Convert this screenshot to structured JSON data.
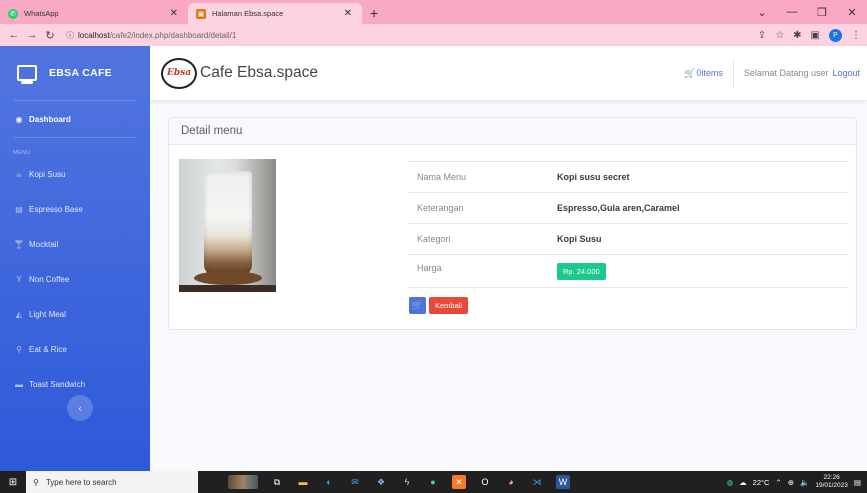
{
  "browser": {
    "tabs": [
      {
        "label": "WhatsApp",
        "favicon_color": "#25d366",
        "favicon": "whatsapp-icon"
      },
      {
        "label": "Halaman Ebsa.space",
        "favicon_color": "#e8710a",
        "favicon": "page-icon"
      }
    ],
    "url_host": "localhost",
    "url_path": "/cafe2/index.php/dashboard/detail/1",
    "profile_initial": "P"
  },
  "sidebar": {
    "brand": "EBSA CAFE",
    "dashboard": "Dashboard",
    "heading": "MENU",
    "items": [
      {
        "label": "Kopi Susu",
        "icon": "coffee-icon"
      },
      {
        "label": "Espresso Base",
        "icon": "book-icon"
      },
      {
        "label": "Mocktail",
        "icon": "cocktail-icon"
      },
      {
        "label": "Non Coffee",
        "icon": "glass-icon"
      },
      {
        "label": "Light Meal",
        "icon": "food-icon"
      },
      {
        "label": "Eat & Rice",
        "icon": "drumstick-icon"
      },
      {
        "label": "Toast Sandwich",
        "icon": "bread-icon"
      }
    ]
  },
  "topbar": {
    "logo_text": "Ebsa",
    "site_name": "Cafe Ebsa.space",
    "cart_label": "0items",
    "welcome": "Selamat Datang user",
    "logout": "Logout"
  },
  "detail": {
    "header": "Detail menu",
    "rows": [
      {
        "label": "Nama Menu",
        "value": "Kopi susu secret"
      },
      {
        "label": "Keterangan",
        "value": "Espresso,Gula aren,Caramel"
      },
      {
        "label": "Kategori",
        "value": "Kopi Susu"
      },
      {
        "label": "Harga",
        "value": "Rp. 24.000"
      }
    ],
    "back_label": "Kembali"
  },
  "taskbar": {
    "search_placeholder": "Type here to search",
    "weather": "22°C",
    "time": "22:26",
    "date": "19/01/2023"
  },
  "colors": {
    "primary": "#4e73df",
    "success": "#1cc88a",
    "danger": "#e74a3b",
    "browser_tabbar": "#f9a8c6"
  }
}
